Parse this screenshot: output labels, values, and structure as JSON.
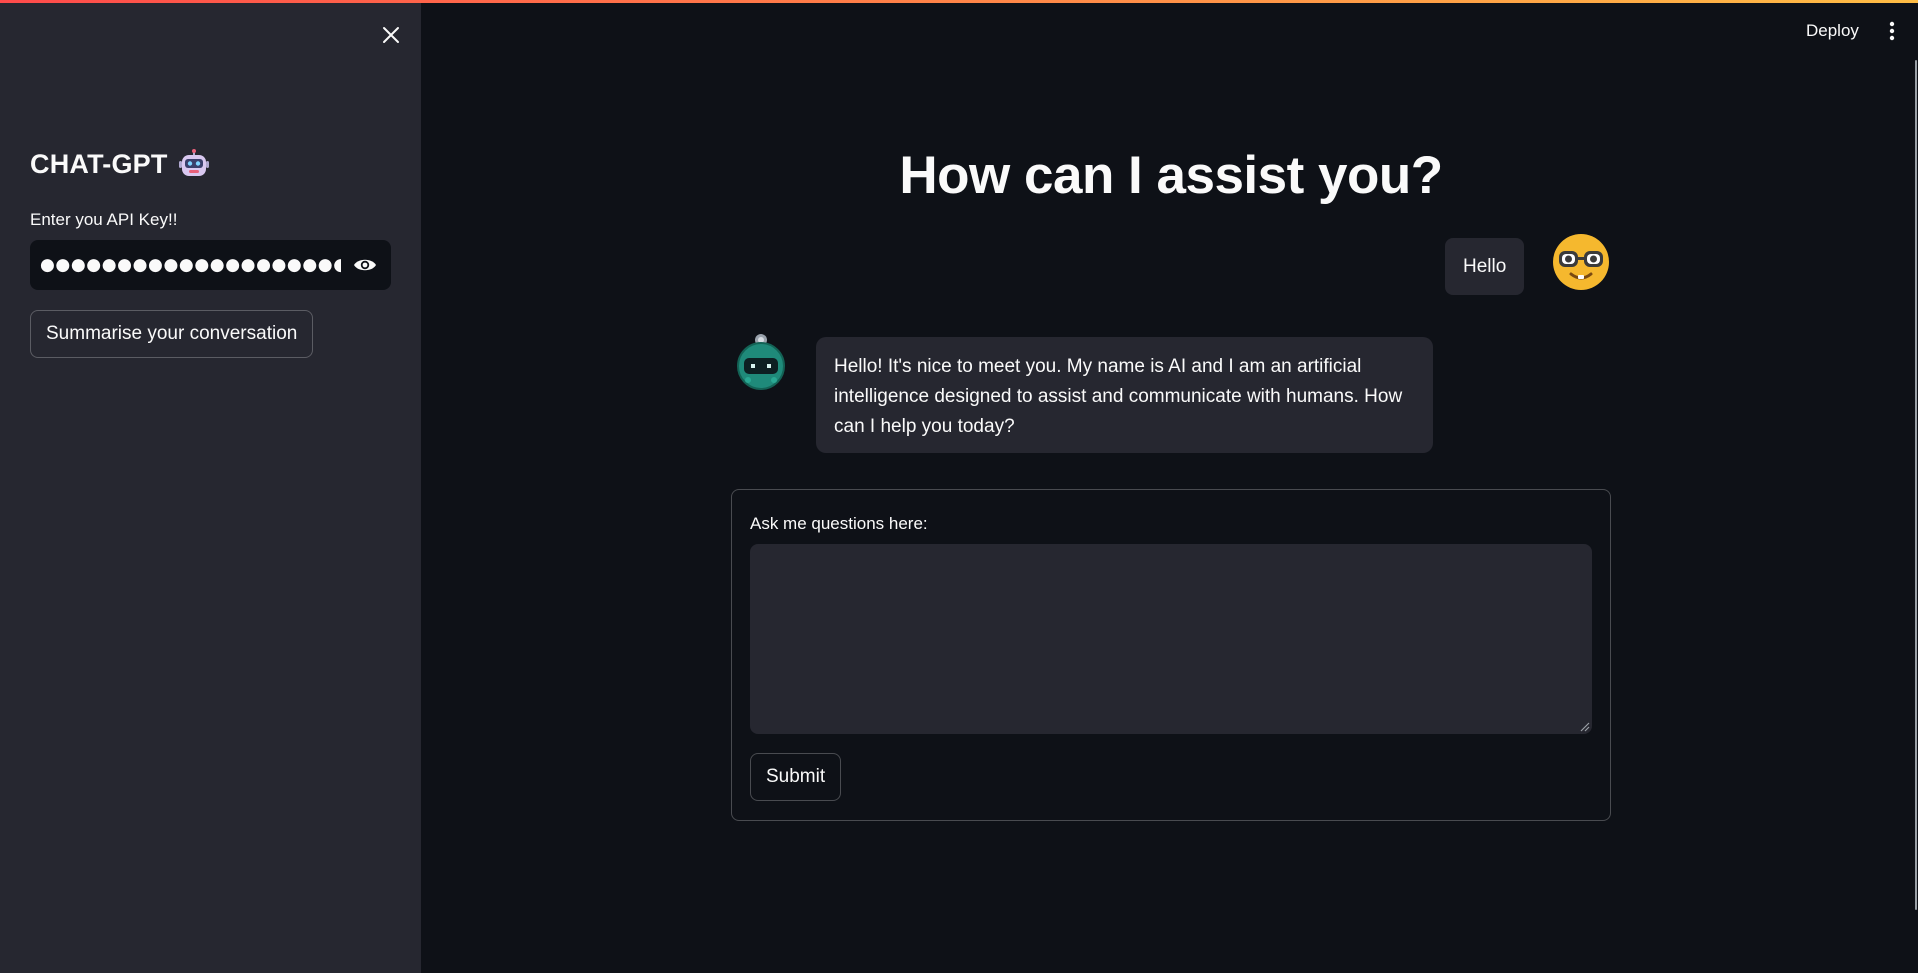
{
  "sidebar": {
    "title": "CHAT-GPT",
    "title_icon": "robot-emoji",
    "api_key_label": "Enter you API Key!!",
    "api_key_masked": "●●●●●●●●●●●●●●●●●●●●●●●",
    "summarise_label": "Summarise your conversation"
  },
  "header": {
    "deploy_label": "Deploy",
    "menu_icon": "vertical-dots-icon"
  },
  "main": {
    "title": "How can I assist you?",
    "messages": [
      {
        "role": "user",
        "text": "Hello",
        "avatar": "nerd-face-emoji"
      },
      {
        "role": "assistant",
        "text": "Hello! It's nice to meet you. My name is AI and I am an artificial intelligence designed to assist and communicate with humans. How can I help you today?",
        "avatar": "robot-avatar"
      }
    ],
    "form": {
      "label": "Ask me questions here:",
      "value": "",
      "submit_label": "Submit"
    }
  },
  "colors": {
    "background": "#0e1117",
    "sidebar": "#262730",
    "bubble": "#262730",
    "accent_gradient_start": "#ff4b4b",
    "accent_gradient_end": "#ffbd45"
  }
}
